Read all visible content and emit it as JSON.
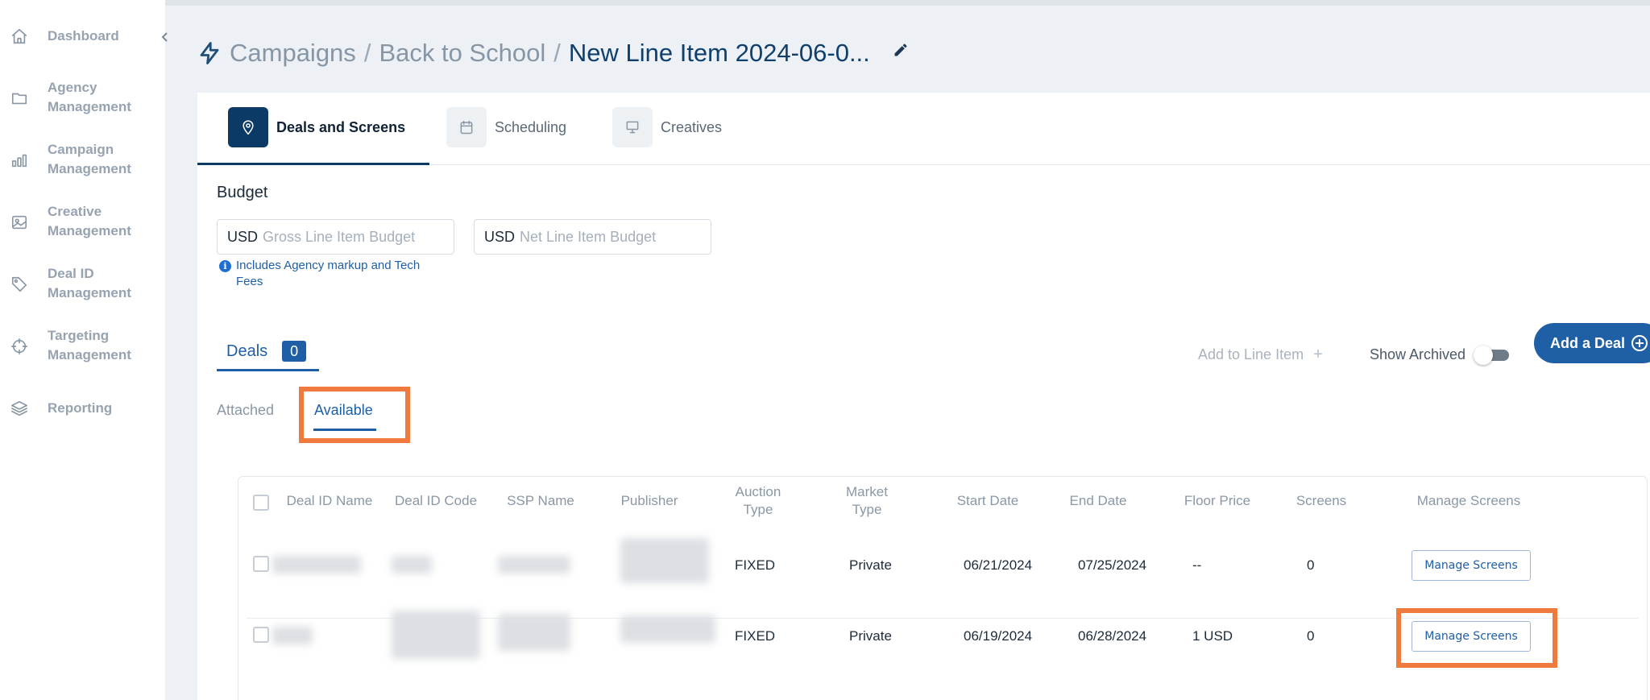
{
  "sidebar": {
    "items": [
      {
        "label": "Dashboard",
        "icon": "home-icon"
      },
      {
        "label": "Agency Management",
        "icon": "folder-icon"
      },
      {
        "label": "Campaign Management",
        "icon": "bar-chart-icon"
      },
      {
        "label": "Creative Management",
        "icon": "image-icon"
      },
      {
        "label": "Deal ID Management",
        "icon": "tag-icon"
      },
      {
        "label": "Targeting Management",
        "icon": "crosshair-icon"
      },
      {
        "label": "Reporting",
        "icon": "layers-icon"
      }
    ],
    "collapse_icon": "chevron-left-icon"
  },
  "header": {
    "crumbs": [
      "Campaigns",
      "Back to School"
    ],
    "separator": "/",
    "current": "New Line Item 2024-06-0...",
    "edit_icon": "pencil-icon",
    "lead_icon": "lightning-icon"
  },
  "tabs": [
    {
      "label": "Deals and Screens",
      "icon": "map-pin-icon",
      "active": true
    },
    {
      "label": "Scheduling",
      "icon": "calendar-icon",
      "active": false
    },
    {
      "label": "Creatives",
      "icon": "monitor-icon",
      "active": false
    }
  ],
  "budget": {
    "title": "Budget",
    "gross": {
      "currency": "USD",
      "placeholder": "Gross Line Item Budget",
      "value": ""
    },
    "net": {
      "currency": "USD",
      "placeholder": "Net Line Item Budget",
      "value": ""
    },
    "hint": "Includes Agency markup and Tech Fees"
  },
  "deals": {
    "label": "Deals",
    "count": "0",
    "add_to_line_label": "Add to Line Item",
    "add_to_line_icon": "+",
    "show_archived_label": "Show Archived",
    "show_archived": false,
    "add_deal_label": "Add a Deal"
  },
  "subtabs": {
    "attached": "Attached",
    "available": "Available",
    "active": "available"
  },
  "table": {
    "columns": [
      "Deal ID Name",
      "Deal ID Code",
      "SSP Name",
      "Publisher",
      "Auction Type",
      "Market Type",
      "Start Date",
      "End Date",
      "Floor Price",
      "Screens",
      "Manage Screens"
    ],
    "rows": [
      {
        "auction_type": "FIXED",
        "market_type": "Private",
        "start_date": "06/21/2024",
        "end_date": "07/25/2024",
        "floor_price": "--",
        "screens": "0",
        "action": "Manage Screens"
      },
      {
        "auction_type": "FIXED",
        "market_type": "Private",
        "start_date": "06/19/2024",
        "end_date": "06/28/2024",
        "floor_price": "1 USD",
        "screens": "0",
        "action": "Manage Screens"
      }
    ]
  },
  "colors": {
    "primary": "#1f5fa6",
    "navy": "#0b3a66",
    "highlight": "#f07a3e"
  }
}
